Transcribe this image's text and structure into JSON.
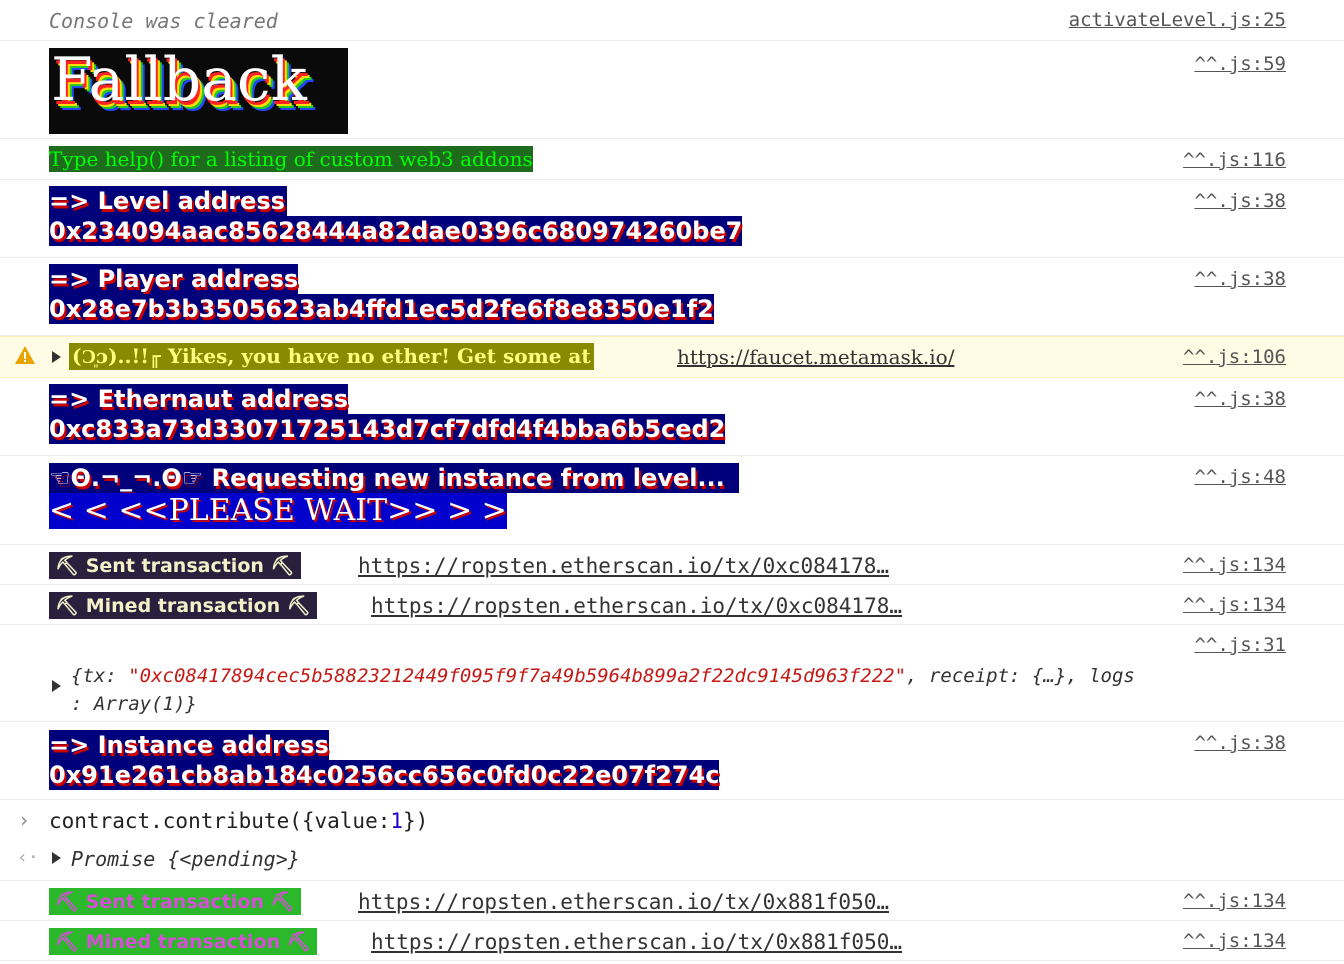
{
  "cleared": {
    "text": "Console was cleared",
    "source": "activateLevel.js:25"
  },
  "fallback": {
    "text": "Fallback",
    "source": "^^.js:59"
  },
  "help": {
    "text": "Type help() for a listing of custom web3 addons",
    "source": "^^.js:116"
  },
  "level": {
    "label": "=> Level address",
    "value": "0x234094aac85628444a82dae0396c680974260be7",
    "source": "^^.js:38"
  },
  "player": {
    "label": "=> Player address",
    "value": "0x28e7b3b3505623ab4ffd1ec5d2fe6f8e8350e1f2",
    "source": "^^.js:38"
  },
  "warning": {
    "text": "(Ɔ͈ɔ)..!!╓ Yikes, you have no ether! Get some at",
    "link": "https://faucet.metamask.io/",
    "source": "^^.js:106"
  },
  "ethernaut": {
    "label": "=> Ethernaut address",
    "value": "0xc833a73d33071725143d7cf7dfd4f4bba6b5ced2",
    "source": "^^.js:38"
  },
  "requesting": {
    "text": "☜Θ.¬_¬.Θ☞ Requesting new instance from level...",
    "wait": "<  <  <<PLEASE WAIT>>  >  >",
    "source": "^^.js:48"
  },
  "sent1": {
    "badge": "⛏ Sent transaction ⛏",
    "link": "https://ropsten.etherscan.io/tx/0xc084178…",
    "source": "^^.js:134"
  },
  "mined1": {
    "badge": "⛏ Mined transaction ⛏",
    "link": "https://ropsten.etherscan.io/tx/0xc084178…",
    "source": "^^.js:134"
  },
  "txobject": {
    "source": "^^.js:31",
    "open": "{tx: ",
    "tx": "\"0xc08417894cec5b58823212449f095f9f7a49b5964b899a2f22dc9145d963f222\"",
    "rest": ", receipt: {…}, logs",
    "line2": ": Array(1)}"
  },
  "instance": {
    "label": "=> Instance address",
    "value": "0x91e261cb8ab184c0256cc656c0fd0c22e07f274c",
    "source": "^^.js:38"
  },
  "command": {
    "prefix": "contract.contribute({value:",
    "num": "1",
    "suffix": "})"
  },
  "promise": {
    "text": "Promise {<pending>}"
  },
  "sent2": {
    "badge": "⛏ Sent transaction ⛏",
    "link": "https://ropsten.etherscan.io/tx/0x881f050…",
    "source": "^^.js:134"
  },
  "mined2": {
    "badge": "⛏ Mined transaction ⛏",
    "link": "https://ropsten.etherscan.io/tx/0x881f050…",
    "source": "^^.js:134"
  },
  "colors": {
    "navy": "#00007a",
    "green": "#1e6b1e",
    "warn_bg": "#fffbe5",
    "badge_dark": "#2a1f3d",
    "badge_green": "#2bb82b",
    "badge_magenta_text": "#d64dd6"
  },
  "icons": {
    "warning": "warning-triangle-icon",
    "expand": "triangle-expand-icon",
    "prompt": "chevron-right-icon",
    "result": "result-arrow-icon"
  }
}
